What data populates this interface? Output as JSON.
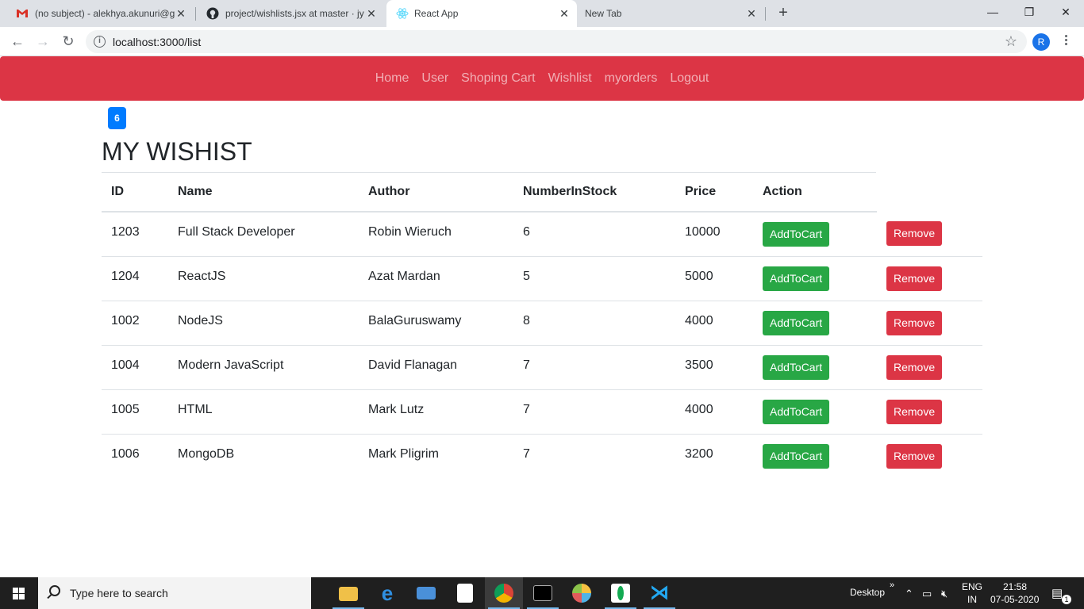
{
  "browser": {
    "tabs": [
      {
        "title": "(no subject) - alekhya.akunuri@g",
        "icon": "gmail-icon",
        "active": false
      },
      {
        "title": "project/wishlists.jsx at master · jy",
        "icon": "github-icon",
        "active": false
      },
      {
        "title": "React App",
        "icon": "react-icon",
        "active": true
      },
      {
        "title": "New Tab",
        "icon": "",
        "active": false
      }
    ],
    "new_tab_label": "+",
    "url": "localhost:3000/list",
    "profile_initial": "R"
  },
  "navbar": {
    "color": "#dc3545",
    "links": [
      "Home",
      "User",
      "Shoping Cart",
      "Wishlist",
      "myorders",
      "Logout"
    ]
  },
  "wishlist": {
    "count_badge": "6",
    "title": "MY WISHIST",
    "columns": [
      "ID",
      "Name",
      "Author",
      "NumberInStock",
      "Price",
      "Action"
    ],
    "rows": [
      {
        "id": "1203",
        "name": "Full Stack Developer",
        "author": "Robin Wieruch",
        "stock": "6",
        "price": "10000"
      },
      {
        "id": "1204",
        "name": "ReactJS",
        "author": "Azat Mardan",
        "stock": "5",
        "price": "5000"
      },
      {
        "id": "1002",
        "name": "NodeJS",
        "author": "BalaGuruswamy",
        "stock": "8",
        "price": "4000"
      },
      {
        "id": "1004",
        "name": "Modern JavaScript",
        "author": "David Flanagan",
        "stock": "7",
        "price": "3500"
      },
      {
        "id": "1005",
        "name": "HTML",
        "author": "Mark Lutz",
        "stock": "7",
        "price": "4000"
      },
      {
        "id": "1006",
        "name": "MongoDB",
        "author": "Mark Pligrim",
        "stock": "7",
        "price": "3200"
      }
    ],
    "add_label": "AddToCart",
    "remove_label": "Remove",
    "add_color": "#28a745",
    "remove_color": "#dc3545"
  },
  "taskbar": {
    "search_placeholder": "Type here to search",
    "apps": [
      "file-explorer-icon",
      "edge-icon",
      "mail-icon",
      "store-icon",
      "chrome-icon",
      "terminal-icon",
      "paint-icon",
      "mongodb-icon",
      "vscode-icon"
    ],
    "desktop_label": "Desktop",
    "language_line1": "ENG",
    "language_line2": "IN",
    "time": "21:58",
    "date": "07-05-2020",
    "notification_count": "1"
  }
}
